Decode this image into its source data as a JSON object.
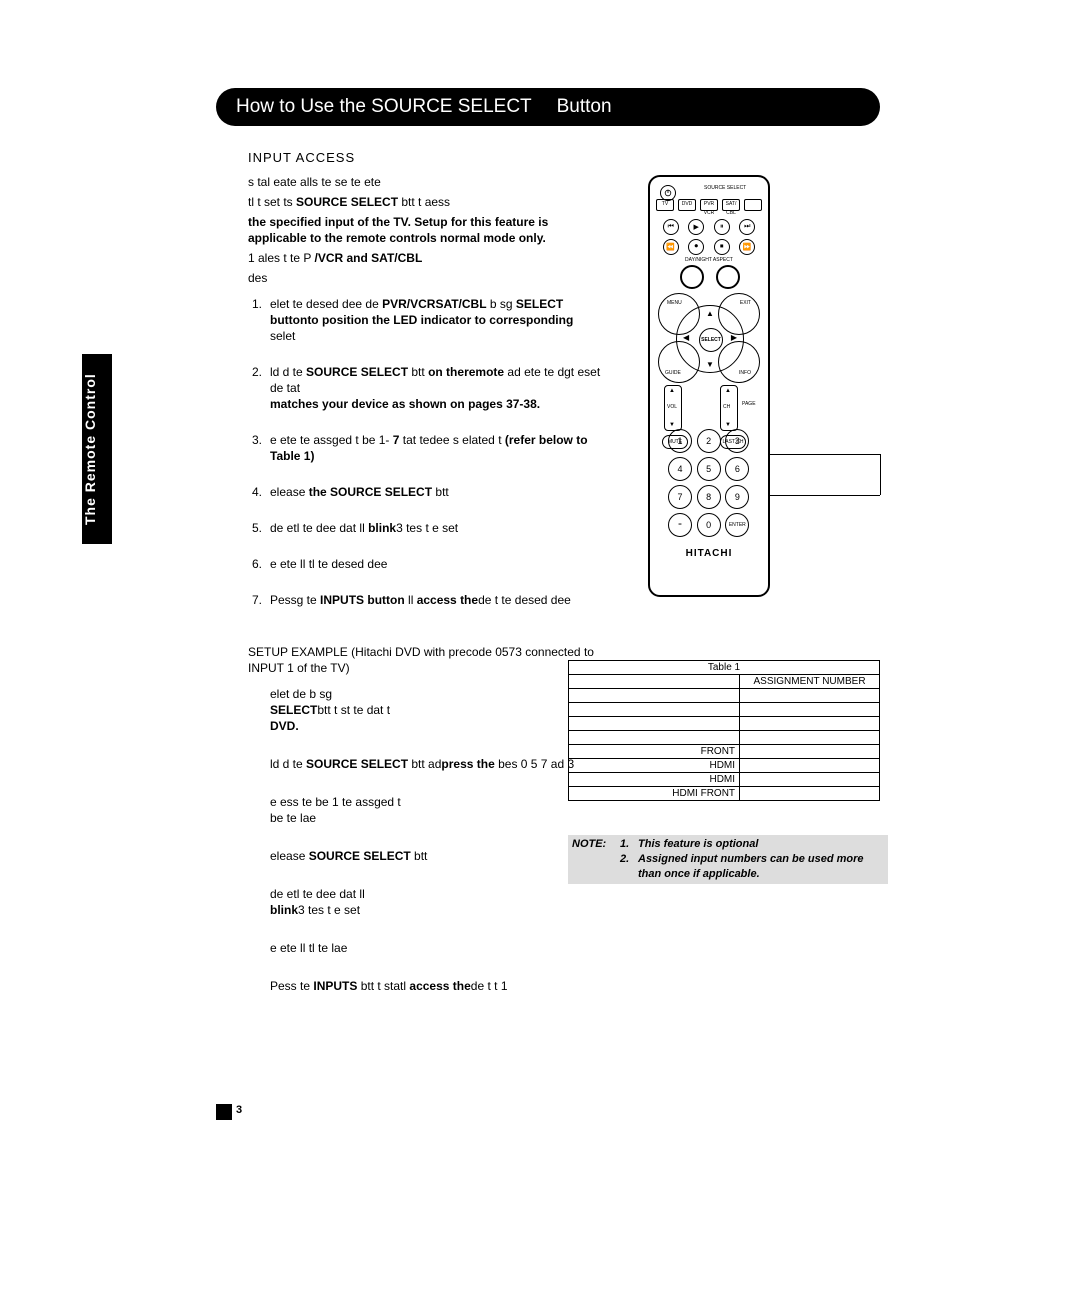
{
  "header": {
    "title_left": "How to Use the SOURCE SELECT",
    "title_right": "Button"
  },
  "sideTab": "The Remote Control",
  "section": {
    "subhead": "INPUT ACCESS",
    "intro1": "s tal eate alls te se   te ete",
    "intro2_a": "tl t set ts ",
    "intro2_b": "SOURCE SELECT",
    "intro2_c": " btt t aess",
    "bold_intro": "the specified input of the TV.  Setup for this feature is applicable to the remote controls normal mode only.",
    "intro3_a": "1  ales t  te  P        ",
    "intro3_b": "/VCR and SAT/CBL",
    "intro3_c": "des",
    "steps": [
      {
        "n": "1",
        "lines": [
          [
            "elet te desed dee de                ",
            "PVR/VCR"
          ],
          [
            "",
            "SAT/CBL"
          ],
          [
            " b sg                       ",
            "SELECT button"
          ],
          [
            "",
            "to position the LED indicator to corresponding"
          ],
          [
            "selet",
            ""
          ]
        ]
      },
      {
        "n": "2",
        "lines": [
          [
            "ld d te ",
            "SOURCE SELECT"
          ],
          [
            " btt ",
            "on the"
          ],
          [
            "",
            "remote"
          ],
          [
            " ad ete te  dgt eset de tat",
            ""
          ],
          [
            "",
            "matches your device as shown on pages 37-38."
          ]
        ]
      },
      {
        "n": "3",
        "lines": [
          [
            "e ete te assged t be 1-            ",
            "7"
          ],
          [
            " tat te",
            ""
          ],
          [
            "dee s elated t ",
            "(refer below to Table 1)"
          ]
        ]
      },
      {
        "n": "4",
        "lines": [
          [
            "elease ",
            "the SOURCE SELECT"
          ],
          [
            " btt",
            ""
          ]
        ]
      },
      {
        "n": "5",
        "lines": [
          [
            "de etl te dee  dat ll                  ",
            "blink"
          ],
          [
            "3 tes t  e set",
            ""
          ]
        ]
      },
      {
        "n": "6",
        "lines": [
          [
            "e ete ll  tl te desed dee",
            ""
          ]
        ]
      },
      {
        "n": "7",
        "lines": [
          [
            "Pessg te ",
            "INPUTS button"
          ],
          [
            " ll  ",
            "access the"
          ],
          [
            "de t  te desed dee",
            ""
          ]
        ]
      }
    ],
    "setup_title": "SETUP EXAMPLE (Hitachi DVD with precode 0573 connected to INPUT 1 of the TV)",
    "ex_steps": [
      {
        "n": "",
        "parts": [
          [
            "elet de b sg                             ",
            ""
          ],
          [
            "",
            "SELECT"
          ],
          [
            "btt t st te  dat t                       ",
            ""
          ],
          [
            "",
            "DVD."
          ]
        ]
      },
      {
        "n": "",
        "parts": [
          [
            "ld d te ",
            "SOURCE SELECT"
          ],
          [
            " btt ad",
            ""
          ],
          [
            "",
            "press the"
          ],
          [
            " bes 0 5 7 ad 3",
            ""
          ]
        ]
      },
      {
        "n": "",
        "parts": [
          [
            "e ess te be 1  te assged t",
            ""
          ],
          [
            "be  te  lae",
            ""
          ]
        ]
      },
      {
        "n": "",
        "parts": [
          [
            "elease ",
            "SOURCE SELECT"
          ],
          [
            " btt",
            ""
          ]
        ]
      },
      {
        "n": "",
        "parts": [
          [
            "de etl te dee  dat ll                  ",
            ""
          ],
          [
            "",
            "blink"
          ],
          [
            "3 tes t  e set",
            ""
          ]
        ]
      },
      {
        "n": "",
        "parts": [
          [
            "e ete ll  tl te  lae",
            ""
          ]
        ]
      },
      {
        "n": "",
        "parts": [
          [
            "Pess te ",
            "INPUTS"
          ],
          [
            " btt t statl ",
            ""
          ],
          [
            "",
            "access the"
          ],
          [
            "de t    t 1",
            ""
          ]
        ]
      }
    ]
  },
  "table": {
    "title": "Table 1",
    "col2": "ASSIGNMENT NUMBER",
    "rows": [
      [
        "",
        ""
      ],
      [
        "",
        ""
      ],
      [
        "",
        ""
      ],
      [
        "",
        ""
      ],
      [
        "FRONT",
        ""
      ],
      [
        "HDMI",
        ""
      ],
      [
        "HDMI",
        ""
      ],
      [
        "HDMI  FRONT",
        ""
      ]
    ]
  },
  "note": {
    "label": "NOTE:",
    "items": [
      {
        "n": "1.",
        "t": "This feature is optional"
      },
      {
        "n": "2.",
        "t": "Assigned input numbers can be used more than once if applicable."
      }
    ]
  },
  "remote": {
    "brand": "HITACHI",
    "source_select": "SOURCE SELECT",
    "mode_buttons": [
      "TV",
      "DVD",
      "PVR VCR",
      "SAT/ CBL",
      ""
    ],
    "transport_row1": [
      "⏮",
      "▶",
      "⏸",
      "⏭"
    ],
    "transport_row2": [
      "⏪",
      "⏺",
      "⏹",
      "⏩"
    ],
    "daynight": "DAY/NIGHT  ASPECT",
    "corner": {
      "tl": "MENU",
      "tr": "EXIT",
      "bl": "GUIDE",
      "br": "INFO"
    },
    "select": "SELECT",
    "vol": "VOL",
    "ch": "CH",
    "page": "PAGE",
    "mute": "MUTE",
    "lastch": "LAST CH",
    "numpad": [
      "1",
      "2",
      "3",
      "4",
      "5",
      "6",
      "7",
      "8",
      "9",
      "-",
      "0",
      "ENTER"
    ]
  },
  "pageNumber": "3"
}
